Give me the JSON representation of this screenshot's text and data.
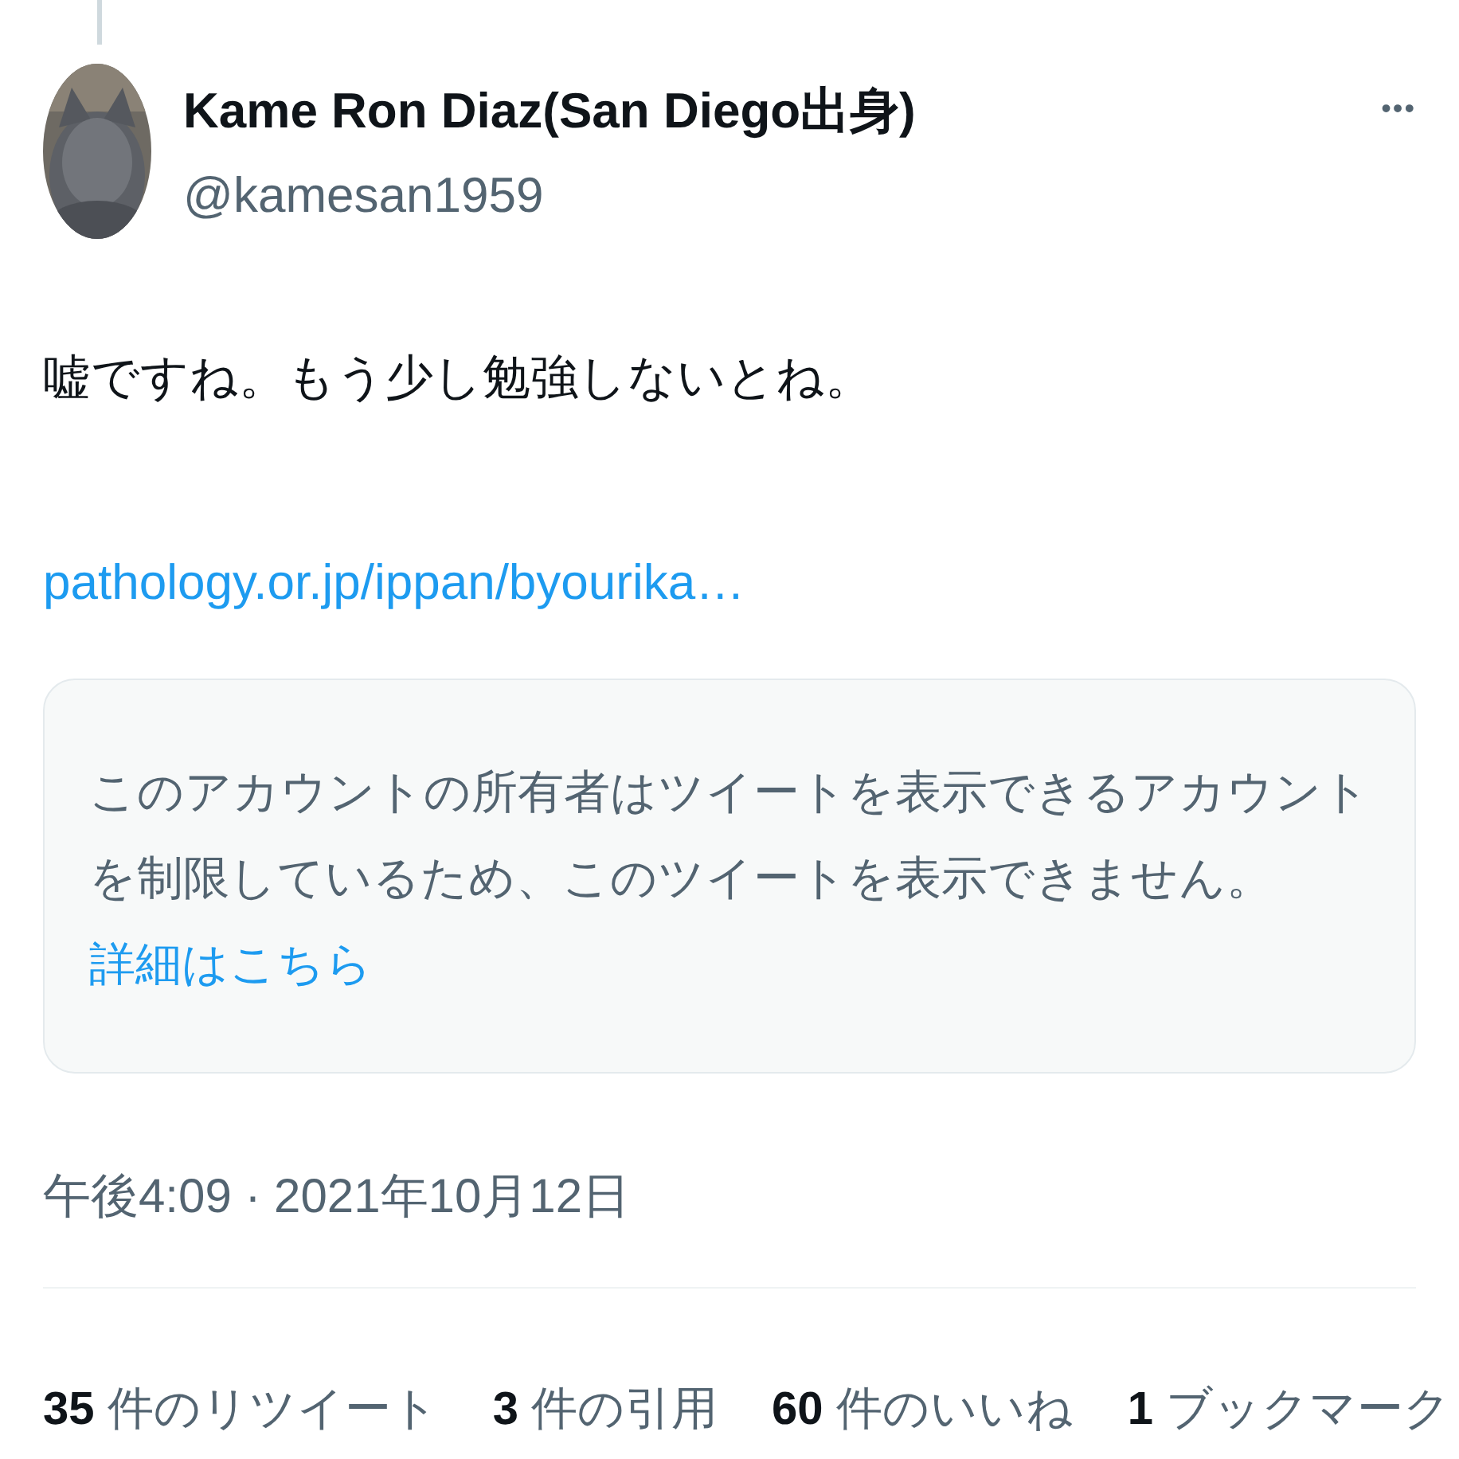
{
  "author": {
    "name": "Kame Ron Diaz(San Diego出身)",
    "handle": "@kamesan1959"
  },
  "more_menu": "•••",
  "text": "嘘ですね。もう少し勉強しないとね。",
  "link": "pathology.or.jp/ippan/byourika…",
  "notice": {
    "text": "このアカウントの所有者はツイートを表示できるアカウントを制限しているため、このツイートを表示できません。",
    "link": "詳細はこちら"
  },
  "timestamp": "午後4:09 · 2021年10月12日",
  "stats": [
    {
      "text": "**35** 件のリツイート"
    },
    {
      "text": "**3** 件の引用"
    },
    {
      "text": "**60** 件のいいね"
    },
    {
      "text": "**1** ブックマーク"
    }
  ]
}
